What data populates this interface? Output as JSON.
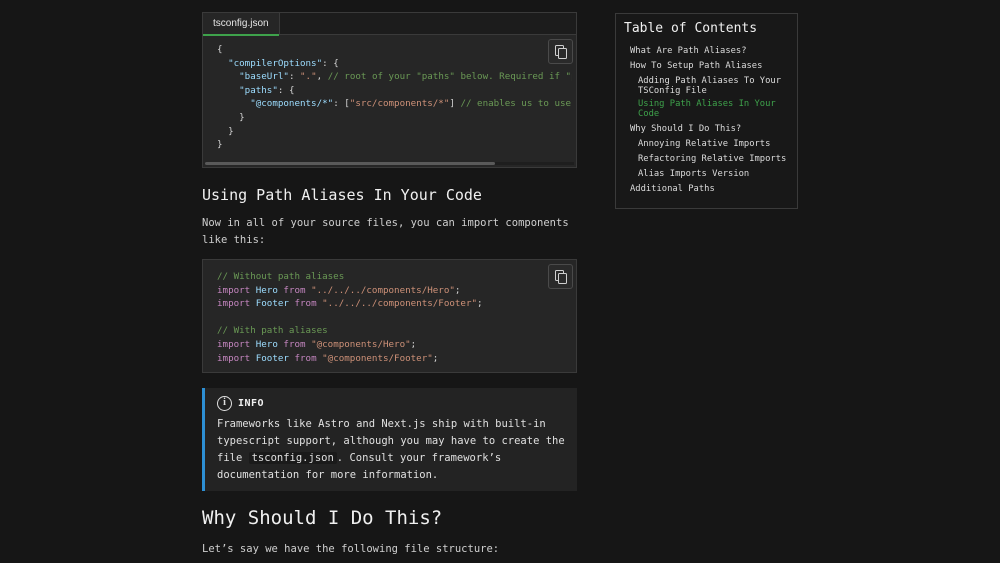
{
  "code_block_1": {
    "tab_label": "tsconfig.json",
    "lines": [
      [
        {
          "t": "{",
          "c": "pun"
        }
      ],
      [
        {
          "t": "  ",
          "c": "pun"
        },
        {
          "t": "\"compilerOptions\"",
          "c": "key"
        },
        {
          "t": ": {",
          "c": "pun"
        }
      ],
      [
        {
          "t": "    ",
          "c": "pun"
        },
        {
          "t": "\"baseUrl\"",
          "c": "key"
        },
        {
          "t": ": ",
          "c": "pun"
        },
        {
          "t": "\".\"",
          "c": "str"
        },
        {
          "t": ", ",
          "c": "pun"
        },
        {
          "t": "// root of your \"paths\" below. Required if \"paths\" is",
          "c": "com"
        }
      ],
      [
        {
          "t": "    ",
          "c": "pun"
        },
        {
          "t": "\"paths\"",
          "c": "key"
        },
        {
          "t": ": {",
          "c": "pun"
        }
      ],
      [
        {
          "t": "      ",
          "c": "pun"
        },
        {
          "t": "\"@components/*\"",
          "c": "key"
        },
        {
          "t": ": [",
          "c": "pun"
        },
        {
          "t": "\"src/components/*\"",
          "c": "str"
        },
        {
          "t": "] ",
          "c": "pun"
        },
        {
          "t": "// enables us to use @componen",
          "c": "com"
        }
      ],
      [
        {
          "t": "    }",
          "c": "pun"
        }
      ],
      [
        {
          "t": "  }",
          "c": "pun"
        }
      ],
      [
        {
          "t": "}",
          "c": "pun"
        }
      ]
    ]
  },
  "section_heading_1": "Using Path Aliases In Your Code",
  "paragraph_1": "Now in all of your source files, you can import components like this:",
  "code_block_2": {
    "lines": [
      [
        {
          "t": "// Without path aliases",
          "c": "com"
        }
      ],
      [
        {
          "t": "import ",
          "c": "imp"
        },
        {
          "t": "Hero ",
          "c": "id"
        },
        {
          "t": "from ",
          "c": "imp"
        },
        {
          "t": "\"../../../components/Hero\"",
          "c": "str"
        },
        {
          "t": ";",
          "c": "pun"
        }
      ],
      [
        {
          "t": "import ",
          "c": "imp"
        },
        {
          "t": "Footer ",
          "c": "id"
        },
        {
          "t": "from ",
          "c": "imp"
        },
        {
          "t": "\"../../../components/Footer\"",
          "c": "str"
        },
        {
          "t": ";",
          "c": "pun"
        }
      ],
      [
        {
          "t": " ",
          "c": "pun"
        }
      ],
      [
        {
          "t": "// With path aliases",
          "c": "com"
        }
      ],
      [
        {
          "t": "import ",
          "c": "imp"
        },
        {
          "t": "Hero ",
          "c": "id"
        },
        {
          "t": "from ",
          "c": "imp"
        },
        {
          "t": "\"@components/Hero\"",
          "c": "str"
        },
        {
          "t": ";",
          "c": "pun"
        }
      ],
      [
        {
          "t": "import ",
          "c": "imp"
        },
        {
          "t": "Footer ",
          "c": "id"
        },
        {
          "t": "from ",
          "c": "imp"
        },
        {
          "t": "\"@components/Footer\"",
          "c": "str"
        },
        {
          "t": ";",
          "c": "pun"
        }
      ]
    ]
  },
  "info": {
    "icon": "info-icon",
    "title": "INFO",
    "text_before": "Frameworks like Astro and Next.js ship with built-in typescript support, although you may have to create the file ",
    "inline_code": "tsconfig.json",
    "text_after": ". Consult your framework’s documentation for more information."
  },
  "section_heading_2": "Why Should I Do This?",
  "paragraph_2": "Let’s say we have the following file structure:",
  "toc": {
    "title": "Table of Contents",
    "items": [
      {
        "label": "What Are Path Aliases?",
        "level": 1,
        "active": false
      },
      {
        "label": "How To Setup Path Aliases",
        "level": 1,
        "active": false
      },
      {
        "label": "Adding Path Aliases To Your TSConfig File",
        "level": 2,
        "active": false
      },
      {
        "label": "Using Path Aliases In Your Code",
        "level": 2,
        "active": true
      },
      {
        "label": "Why Should I Do This?",
        "level": 1,
        "active": false
      },
      {
        "label": "Annoying Relative Imports",
        "level": 2,
        "active": false
      },
      {
        "label": "Refactoring Relative Imports",
        "level": 2,
        "active": false
      },
      {
        "label": "Alias Imports Version",
        "level": 2,
        "active": false
      },
      {
        "label": "Additional Paths",
        "level": 1,
        "active": false
      }
    ]
  },
  "colors": {
    "background": "#161616",
    "accent_green": "#3ea24b",
    "info_border": "#2d8fd4"
  }
}
